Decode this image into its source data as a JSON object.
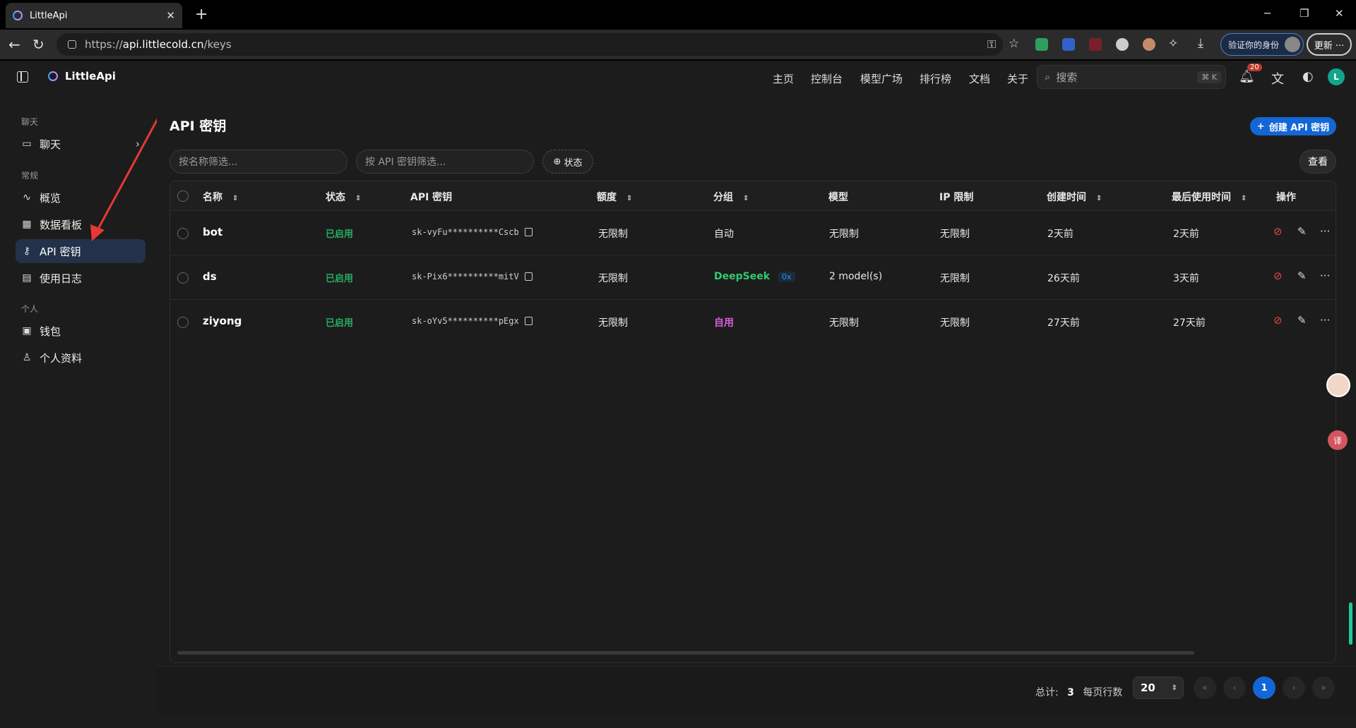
{
  "browser": {
    "tab_title": "LittleApi",
    "url_prefix": "https://",
    "url_host": "api.littlecold.cn",
    "url_path": "/keys",
    "verify_label": "验证你的身份",
    "update_label": "更新 ···"
  },
  "app": {
    "brand": "LittleApi",
    "nav": [
      "主页",
      "控制台",
      "模型广场",
      "排行榜",
      "文档",
      "关于"
    ],
    "search_placeholder": "搜索",
    "search_shortcut": "⌘ K",
    "notif_count": "20",
    "user_initial": "L"
  },
  "sidebar": {
    "groups": [
      "聊天",
      "常规",
      "个人"
    ],
    "items": [
      {
        "label": "聊天",
        "icon": "chat-icon"
      },
      {
        "label": "概览",
        "icon": "activity-icon"
      },
      {
        "label": "数据看板",
        "icon": "dashboard-icon"
      },
      {
        "label": "API 密钥",
        "icon": "key-icon"
      },
      {
        "label": "使用日志",
        "icon": "log-icon"
      },
      {
        "label": "钱包",
        "icon": "wallet-icon"
      },
      {
        "label": "个人资料",
        "icon": "user-icon"
      }
    ]
  },
  "page": {
    "title": "API 密钥",
    "create_label": "创建 API 密钥",
    "name_filter_placeholder": "按名称筛选...",
    "key_filter_placeholder": "按 API 密钥筛选...",
    "status_filter_label": "状态",
    "view_label": "查看"
  },
  "table": {
    "columns": [
      "名称",
      "状态",
      "API 密钥",
      "额度",
      "分组",
      "模型",
      "IP 限制",
      "创建时间",
      "最后使用时间",
      "操作"
    ],
    "rows": [
      {
        "name": "bot",
        "status": "已启用",
        "key": "sk-vyFu**********Cscb",
        "quota": "无限制",
        "group": "自动",
        "group_ratio": "",
        "model": "无限制",
        "ip": "无限制",
        "created": "2天前",
        "last_used": "2天前"
      },
      {
        "name": "ds",
        "status": "已启用",
        "key": "sk-Pix6**********mitV",
        "quota": "无限制",
        "group": "DeepSeek",
        "group_ratio": "0x",
        "model": "2 model(s)",
        "ip": "无限制",
        "created": "26天前",
        "last_used": "3天前"
      },
      {
        "name": "ziyong",
        "status": "已启用",
        "key": "sk-oYv5**********pEgx",
        "quota": "无限制",
        "group": "自用",
        "group_ratio": "",
        "model": "无限制",
        "ip": "无限制",
        "created": "27天前",
        "last_used": "27天前"
      }
    ]
  },
  "pagination": {
    "total_label": "总计:",
    "total": "3",
    "rows_per_page_label": "每页行数",
    "page_size": "20",
    "current_page": "1"
  },
  "colors": {
    "accent": "#1366d6",
    "status_enabled": "#27ae60",
    "group_auto": "#e8e8e8",
    "group_deepseek": "#2ecc71",
    "group_self": "#d65fd6",
    "danger": "#e74c3c"
  }
}
